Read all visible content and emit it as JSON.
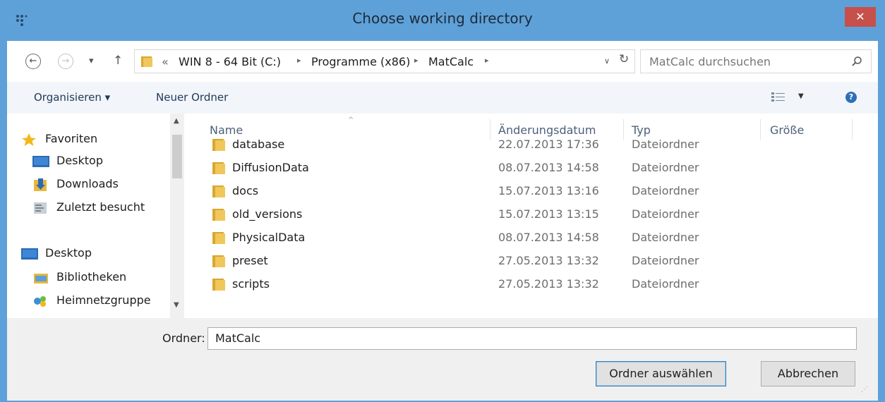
{
  "window": {
    "title": "Choose working directory",
    "close_label": "✕"
  },
  "nav": {
    "back_glyph": "←",
    "forward_glyph": "→",
    "recent_glyph": "▾",
    "up_glyph": "↑",
    "overflow": "«",
    "path": [
      "WIN 8 - 64 Bit (C:)",
      "Programme (x86)",
      "MatCalc"
    ],
    "sep_glyph": "▸",
    "dropdown_glyph": "∨",
    "refresh_glyph": "↻",
    "search_placeholder": "MatCalc durchsuchen"
  },
  "toolbar": {
    "organize_label": "Organisieren ▾",
    "new_folder_label": "Neuer Ordner",
    "view_dropdown_glyph": "▼",
    "help_glyph": "?"
  },
  "sidebar": {
    "items": [
      {
        "label": "Favoriten",
        "icon": "star-icon"
      },
      {
        "label": "Desktop",
        "icon": "desktop-icon"
      },
      {
        "label": "Downloads",
        "icon": "downloads-icon"
      },
      {
        "label": "Zuletzt besucht",
        "icon": "recent-places-icon"
      },
      {
        "label": "Desktop",
        "icon": "desktop-icon"
      },
      {
        "label": "Bibliotheken",
        "icon": "libraries-icon"
      },
      {
        "label": "Heimnetzgruppe",
        "icon": "homegroup-icon"
      }
    ],
    "scroll_up": "▲",
    "scroll_down": "▼"
  },
  "file_list": {
    "columns": [
      "Name",
      "Änderungsdatum",
      "Typ",
      "Größe"
    ],
    "sort_indicator": "^",
    "rows": [
      {
        "name": "database",
        "date": "22.07.2013 17:36",
        "type": "Dateiordner"
      },
      {
        "name": "DiffusionData",
        "date": "08.07.2013 14:58",
        "type": "Dateiordner"
      },
      {
        "name": "docs",
        "date": "15.07.2013 13:16",
        "type": "Dateiordner"
      },
      {
        "name": "old_versions",
        "date": "15.07.2013 13:15",
        "type": "Dateiordner"
      },
      {
        "name": "PhysicalData",
        "date": "08.07.2013 14:58",
        "type": "Dateiordner"
      },
      {
        "name": "preset",
        "date": "27.05.2013 13:32",
        "type": "Dateiordner"
      },
      {
        "name": "scripts",
        "date": "27.05.2013 13:32",
        "type": "Dateiordner"
      }
    ]
  },
  "footer": {
    "folder_label": "Ordner:",
    "folder_value": "MatCalc",
    "select_button": "Ordner auswählen",
    "cancel_button": "Abbrechen"
  },
  "colors": {
    "titlebar": "#5ea1d8",
    "close": "#c7504b",
    "folder": "#e8b83c",
    "toolbar": "#f2f5f9"
  }
}
